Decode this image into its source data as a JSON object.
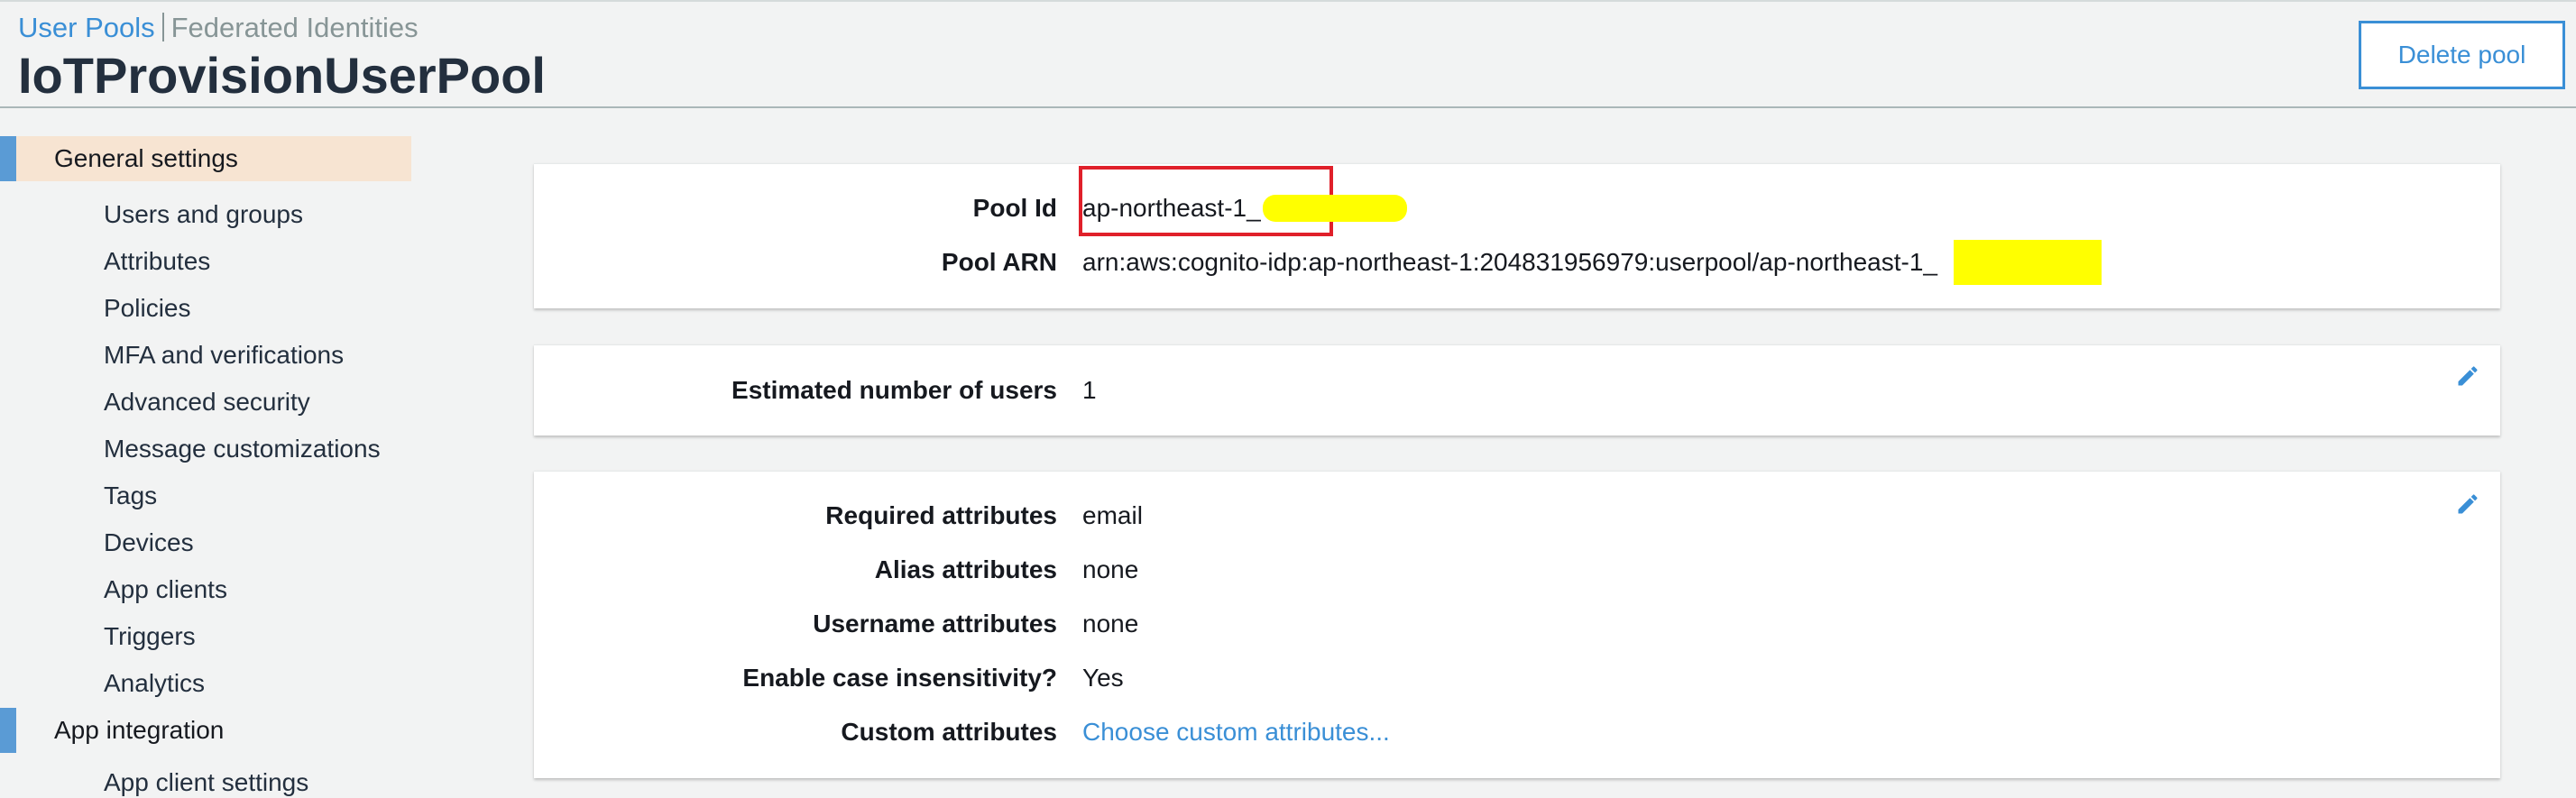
{
  "header": {
    "crumbs": {
      "active": "User Pools",
      "other": "Federated Identities"
    },
    "title": "IoTProvisionUserPool",
    "delete_label": "Delete pool"
  },
  "sidebar": {
    "sections": [
      {
        "label": "General settings",
        "selected": true
      },
      {
        "label": "App integration",
        "selected": false
      }
    ],
    "items": [
      "Users and groups",
      "Attributes",
      "Policies",
      "MFA and verifications",
      "Advanced security",
      "Message customizations",
      "Tags",
      "Devices",
      "App clients",
      "Triggers",
      "Analytics"
    ],
    "sub_items": [
      "App client settings"
    ]
  },
  "pool_panel": {
    "pool_id": {
      "label": "Pool Id",
      "value": "ap-northeast-1_"
    },
    "pool_arn": {
      "label": "Pool ARN",
      "value": "arn:aws:cognito-idp:ap-northeast-1:204831956979:userpool/ap-northeast-1_"
    }
  },
  "users_panel": {
    "estimated_users": {
      "label": "Estimated number of users",
      "value": "1"
    }
  },
  "attributes_panel": {
    "required": {
      "label": "Required attributes",
      "value": "email"
    },
    "alias": {
      "label": "Alias attributes",
      "value": "none"
    },
    "username": {
      "label": "Username attributes",
      "value": "none"
    },
    "case": {
      "label": "Enable case insensitivity?",
      "value": "Yes"
    },
    "custom": {
      "label": "Custom attributes",
      "value": "Choose custom attributes..."
    }
  },
  "colors": {
    "accent": "#3a8fd6",
    "selected_bg": "#f7e4d2",
    "highlight_border": "#e0202a",
    "redaction": "#ffff00"
  },
  "icons": [
    "pencil-icon"
  ]
}
